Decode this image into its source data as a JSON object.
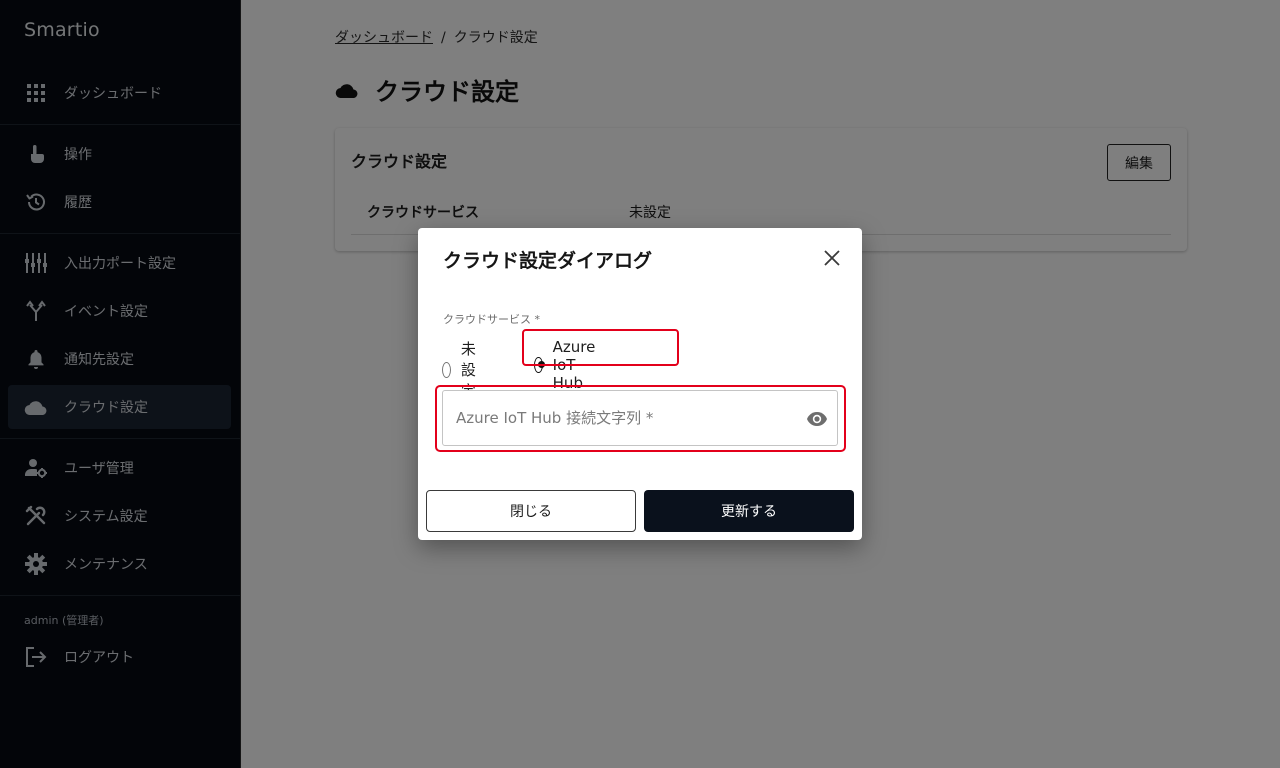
{
  "app": {
    "brand": "Smartio"
  },
  "sidebar": {
    "items": [
      {
        "label": "ダッシュボード",
        "icon": "grid-icon"
      },
      {
        "label": "操作",
        "icon": "touch-icon"
      },
      {
        "label": "履歴",
        "icon": "history-icon"
      },
      {
        "label": "入出力ポート設定",
        "icon": "sliders-icon"
      },
      {
        "label": "イベント設定",
        "icon": "fork-icon"
      },
      {
        "label": "通知先設定",
        "icon": "bell-icon"
      },
      {
        "label": "クラウド設定",
        "icon": "cloud-icon",
        "active": true
      },
      {
        "label": "ユーザ管理",
        "icon": "user-gear-icon"
      },
      {
        "label": "システム設定",
        "icon": "tools-icon"
      },
      {
        "label": "メンテナンス",
        "icon": "gear-icon"
      },
      {
        "label": "ログアウト",
        "icon": "logout-icon"
      }
    ],
    "user_label": "admin (管理者)"
  },
  "breadcrumb": {
    "link": "ダッシュボード",
    "separator": "/",
    "current": "クラウド設定"
  },
  "page": {
    "title": "クラウド設定"
  },
  "card": {
    "title": "クラウド設定",
    "edit_label": "編集",
    "row": {
      "label": "クラウドサービス",
      "value": "未設定"
    }
  },
  "dialog": {
    "title": "クラウド設定ダイアログ",
    "field_label": "クラウドサービス *",
    "options": [
      {
        "label": "未設定",
        "selected": false
      },
      {
        "label": "Azure IoT Hub",
        "selected": true
      }
    ],
    "input_placeholder": "Azure IoT Hub 接続文字列 *",
    "close_label": "閉じる",
    "update_label": "更新する"
  },
  "colors": {
    "sidebar_bg": "#060b13",
    "highlight": "#e3001b",
    "primary_button": "#0a111c"
  }
}
